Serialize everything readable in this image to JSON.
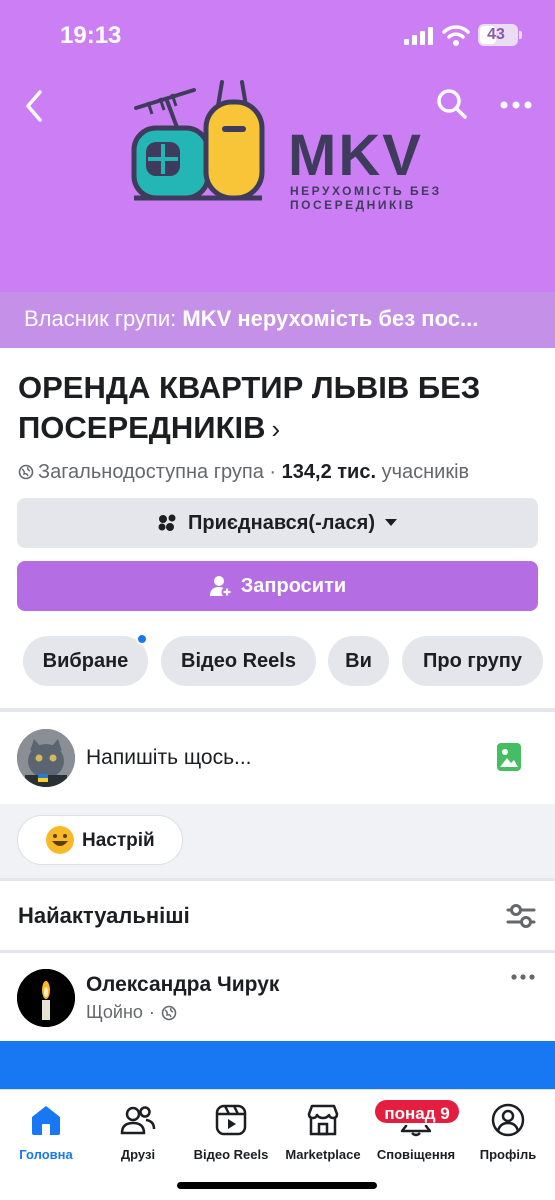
{
  "status": {
    "time": "19:13",
    "battery": "43"
  },
  "header": {
    "logo_title": "MKV",
    "logo_tagline_1": "НЕРУХОМІСТЬ БЕЗ",
    "logo_tagline_2": "ПОСЕРЕДНИКІВ",
    "owner_prefix": "Власник групи: ",
    "owner_name": "MKV нерухомість без пос..."
  },
  "group": {
    "title": "ОРЕНДА КВАРТИР ЛЬВІВ БЕЗ ПОСЕРЕДНИКІВ",
    "chevron": "›",
    "privacy": "Загальнодоступна група · ",
    "members_count": "134,2 тис.",
    "members_label": " учасників",
    "joined_label": "Приєднався(-лася)",
    "invite_label": "Запросити"
  },
  "chips": [
    "Вибране",
    "Відео Reels",
    "Ви",
    "Про групу"
  ],
  "composer": {
    "placeholder": "Напишіть щось...",
    "mood_label": "Настрій"
  },
  "feed": {
    "sort_title": "Найактуальніші",
    "post": {
      "author": "Олександра Чирук",
      "time": "Щойно",
      "separator": "·"
    }
  },
  "tabbar": {
    "items": [
      {
        "label": "Головна",
        "icon": "home-icon",
        "active": true
      },
      {
        "label": "Друзі",
        "icon": "friends-icon",
        "active": false
      },
      {
        "label": "Відео Reels",
        "icon": "reels-icon",
        "active": false
      },
      {
        "label": "Marketplace",
        "icon": "marketplace-icon",
        "active": false
      },
      {
        "label": "Сповіщення",
        "icon": "bell-icon",
        "active": false
      },
      {
        "label": "Профіль",
        "icon": "profile-icon",
        "active": false
      }
    ],
    "notif_badge": "понад 9"
  },
  "colors": {
    "cover": "#cc7ff5",
    "accent": "#b46de3",
    "brand_blue": "#1877f2",
    "badge_red": "#e41e3f"
  }
}
